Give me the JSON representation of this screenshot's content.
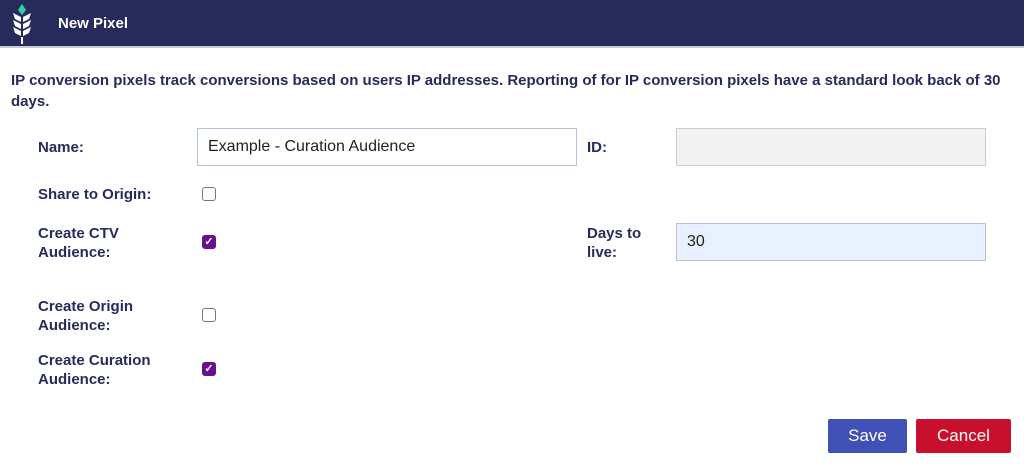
{
  "header": {
    "title": "New Pixel"
  },
  "intro": "IP conversion pixels track conversions based on users IP addresses. Reporting of for IP conversion pixels have a standard look back of 30 days.",
  "form": {
    "name_label": "Name:",
    "name_value": "Example - Curation Audience",
    "id_label": "ID:",
    "id_value": "",
    "share_origin_label": "Share to Origin:",
    "share_origin_checked": false,
    "ctv_label": "Create CTV Audience:",
    "ctv_checked": true,
    "days_label": "Days to live:",
    "days_value": "30",
    "origin_aud_label": "Create Origin Audience:",
    "origin_aud_checked": false,
    "curation_label": "Create Curation Audience:",
    "curation_checked": true
  },
  "buttons": {
    "save": "Save",
    "cancel": "Cancel"
  },
  "colors": {
    "header": "#262b5c",
    "save": "#3f51b5",
    "cancel": "#c8102e",
    "checkbox": "#6a0f8e"
  }
}
